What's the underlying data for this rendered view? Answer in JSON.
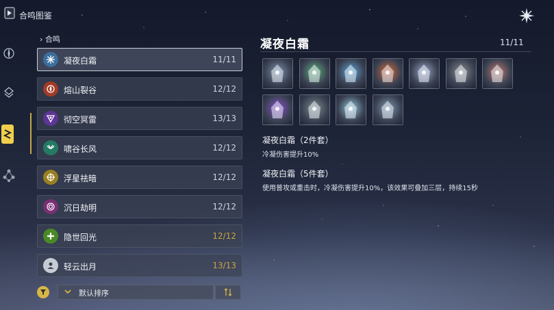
{
  "app": {
    "title": "合鸣图鉴"
  },
  "list": {
    "section_label": "合鸣",
    "items": [
      {
        "name": "凝夜白霜",
        "count": "11/11",
        "icon": "snowflake-icon",
        "color": "#4aa7d9"
      },
      {
        "name": "熔山裂谷",
        "count": "12/12",
        "icon": "flame-icon",
        "color": "#d9532f"
      },
      {
        "name": "彻空冥雷",
        "count": "13/13",
        "icon": "thunder-icon",
        "color": "#8a4fd0"
      },
      {
        "name": "啸谷长风",
        "count": "12/12",
        "icon": "wind-icon",
        "color": "#36b58e"
      },
      {
        "name": "浮星祛暗",
        "count": "12/12",
        "icon": "star-icon",
        "color": "#d5b23a"
      },
      {
        "name": "沉日劫明",
        "count": "12/12",
        "icon": "spiral-icon",
        "color": "#b04aa8"
      },
      {
        "name": "隐世回光",
        "count": "12/12",
        "icon": "cross-icon",
        "color": "#6bbf3a"
      },
      {
        "name": "轻云出月",
        "count": "13/13",
        "icon": "moon-icon",
        "color": "#c6ccd6"
      }
    ]
  },
  "sort": {
    "label": "默认排序"
  },
  "detail": {
    "title": "凝夜白霜",
    "count": "11/11",
    "set2": {
      "title": "凝夜白霜（2件套）",
      "text": "冷凝伤害提升10%"
    },
    "set5": {
      "title": "凝夜白霜（5件套）",
      "text": "使用普攻或重击时，冷凝伤害提升10%，该效果可叠加三层，持续15秒"
    }
  },
  "echoes": [
    {
      "icon": "echo-blade-icon",
      "color": "#7d93ad"
    },
    {
      "icon": "echo-puff-icon",
      "color": "#5fb07a"
    },
    {
      "icon": "echo-crystal-icon",
      "color": "#5fa6d6"
    },
    {
      "icon": "echo-flame-beast-icon",
      "color": "#d86a3a"
    },
    {
      "icon": "echo-knight-icon",
      "color": "#9aa4c8"
    },
    {
      "icon": "echo-armor-icon",
      "color": "#8c8c8c"
    },
    {
      "icon": "echo-mask-icon",
      "color": "#c07a6a"
    },
    {
      "icon": "echo-orb-icon",
      "color": "#8a4fd0"
    },
    {
      "icon": "echo-golem-icon",
      "color": "#7a8c8a"
    },
    {
      "icon": "echo-frost-dragon-icon",
      "color": "#8fc6d8"
    },
    {
      "icon": "echo-mech-icon",
      "color": "#7f97b0"
    }
  ]
}
